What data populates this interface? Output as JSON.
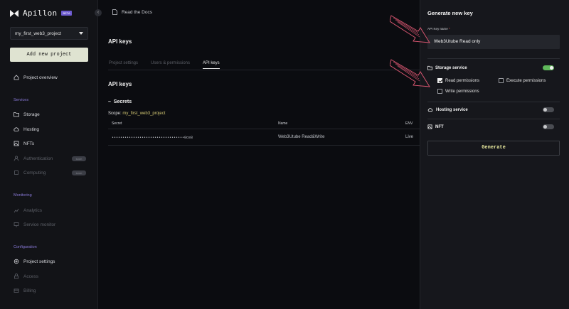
{
  "app": {
    "name": "Apillon",
    "badge": "BETA"
  },
  "sidebar": {
    "project_selected": "my_first_web3_project",
    "add_project_label": "Add new project",
    "overview_label": "Project overview",
    "sections": {
      "services": "Services",
      "monitoring": "Monitoring",
      "configuration": "Configuration"
    },
    "items": {
      "storage": "Storage",
      "hosting": "Hosting",
      "nfts": "NFTs",
      "authentication": "Authentication",
      "computing": "Computing",
      "analytics": "Analytics",
      "service_monitor": "Service monitor",
      "project_settings": "Project settings",
      "access": "Access",
      "billing": "Billing"
    },
    "soon_badge": "soon"
  },
  "topbar": {
    "docs_label": "Read the Docs"
  },
  "main": {
    "title": "API keys",
    "tabs": [
      "Project settings",
      "Users & permissions",
      "API keys"
    ],
    "active_tab": "API keys",
    "subtitle": "API keys",
    "secrets_label": "Secrets",
    "scope_prefix": "Scope:",
    "scope_project": "my_first_web3_project",
    "table": {
      "columns": [
        "Secret",
        "Name",
        "ENV"
      ],
      "rows": [
        {
          "secret": "••••••••••••••••••••••••••••••••••0ce8",
          "name": "Web3Utube Read&Write",
          "env": "Live"
        }
      ]
    }
  },
  "panel": {
    "title": "Generate new key",
    "name_label": "API Key name",
    "required_mark": "*",
    "name_value": "Web3Utube Read only",
    "services": {
      "storage": {
        "label": "Storage service",
        "enabled": true
      },
      "hosting": {
        "label": "Hosting service",
        "enabled": false
      },
      "nft": {
        "label": "NFT",
        "enabled": false
      }
    },
    "permissions": {
      "read": {
        "label": "Read permissions",
        "checked": true
      },
      "execute": {
        "label": "Execute permissions",
        "checked": false
      },
      "write": {
        "label": "Write permissions",
        "checked": false
      }
    },
    "generate_label": "Generate"
  },
  "colors": {
    "accent_purple": "#8a7ad9",
    "highlight_yellow": "#d3c873",
    "toggle_on": "#5fb85a",
    "annotation_arrow": "#d5556f"
  }
}
